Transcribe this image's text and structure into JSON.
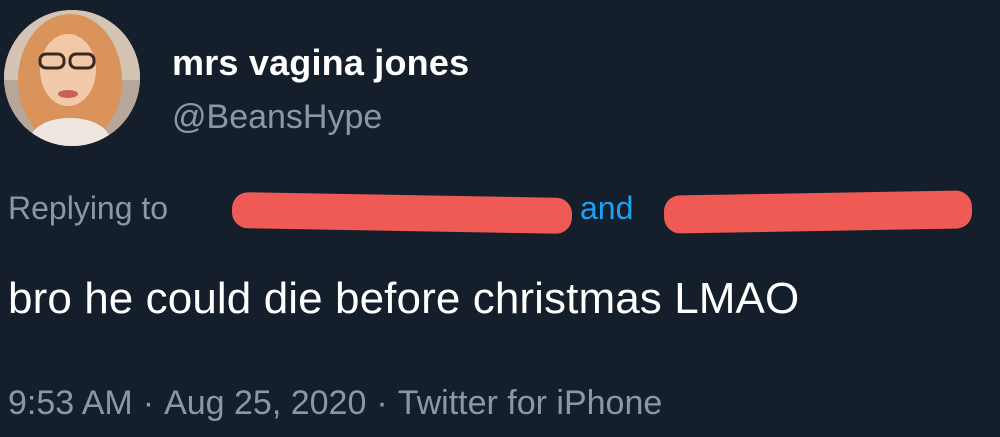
{
  "tweet": {
    "display_name": "mrs vagina jones",
    "handle": "@BeansHype",
    "replying_to_label": "Replying to",
    "replying_conjunction": "and",
    "text": "bro he could die before christmas LMAO",
    "time": "9:53 AM",
    "separator": "·",
    "date": "Aug 25, 2020",
    "client": "Twitter for iPhone"
  },
  "icons": {
    "avatar": "profile-photo"
  },
  "colors": {
    "background": "#151f2b",
    "primary_text": "#ffffff",
    "secondary_text": "#8899a6",
    "link": "#1da1f2",
    "redaction": "#ef5a54"
  }
}
